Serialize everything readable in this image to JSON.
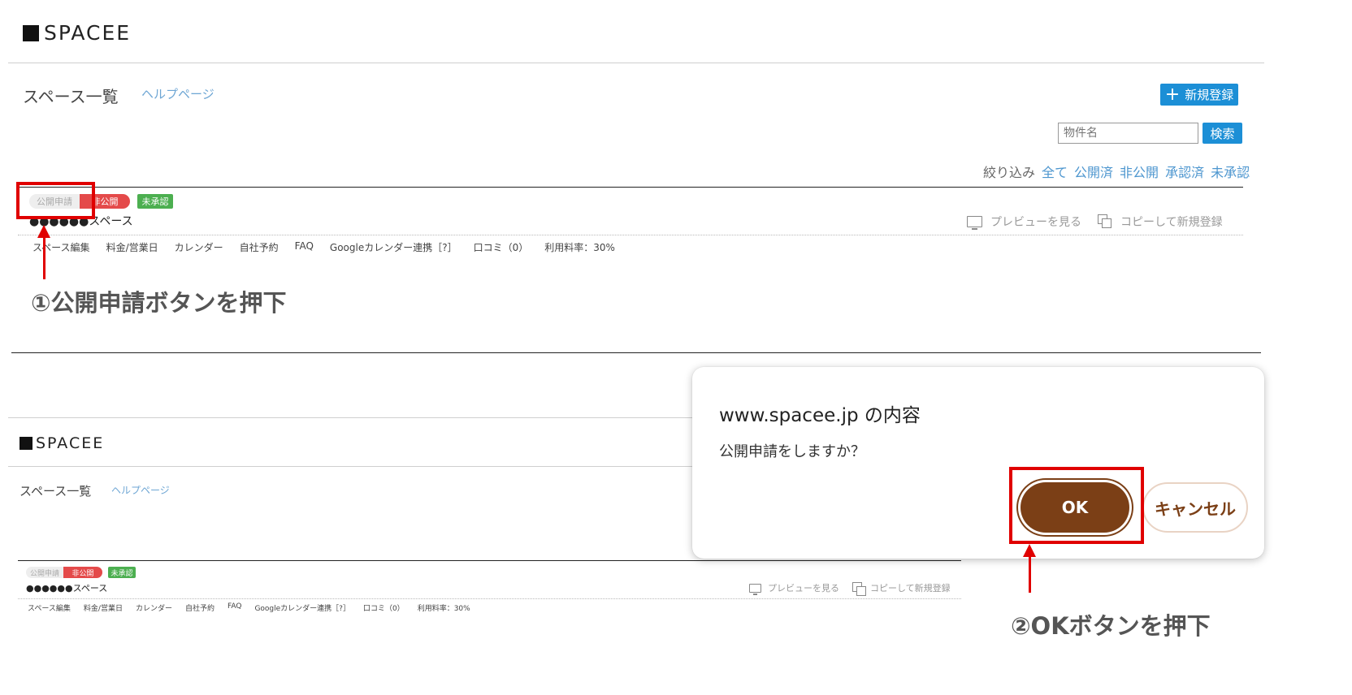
{
  "top": {
    "logo": "SPACEE",
    "title": "スペース一覧",
    "help": "ヘルプページ",
    "new_button": "新規登録",
    "search_placeholder": "物件名",
    "search_button": "検索",
    "filter": {
      "label": "絞り込み",
      "options": [
        "全て",
        "公開済",
        "非公開",
        "承認済",
        "未承認"
      ]
    },
    "badges": {
      "apply": "公開申請",
      "private": "非公開",
      "unapproved": "未承認"
    },
    "space_name": "●●●●●●スペース",
    "preview": "プレビューを見る",
    "copy_new": "コピーして新規登録",
    "links": [
      "スペース編集",
      "料金/営業日",
      "カレンダー",
      "自社予約",
      "FAQ",
      "Googleカレンダー連携［?］",
      "口コミ（0）",
      "利用料率：30%"
    ]
  },
  "annotations": {
    "step1": "①公開申請ボタンを押下",
    "step2": "②OKボタンを押下"
  },
  "bottom": {
    "logo": "SPACEE",
    "title": "スペース一覧",
    "help": "ヘルプページ",
    "badges": {
      "apply": "公開申請",
      "private": "非公開",
      "unapproved": "未承認"
    },
    "space_name": "●●●●●●スペース",
    "preview": "プレビューを見る",
    "copy_new": "コピーして新規登録",
    "links": [
      "スペース編集",
      "料金/営業日",
      "カレンダー",
      "自社予約",
      "FAQ",
      "Googleカレンダー連携［?］",
      "口コミ（0）",
      "利用料率：30%"
    ]
  },
  "dialog": {
    "title": "www.spacee.jp の内容",
    "message": "公開申請をしますか？",
    "ok": "OK",
    "cancel": "キャンセル"
  },
  "colors": {
    "primary_blue": "#1c8fd6",
    "annotation_red": "#e00000",
    "ok_brown": "#7b3f16",
    "private_red": "#e44a4a",
    "unapproved_green": "#4caf50"
  }
}
